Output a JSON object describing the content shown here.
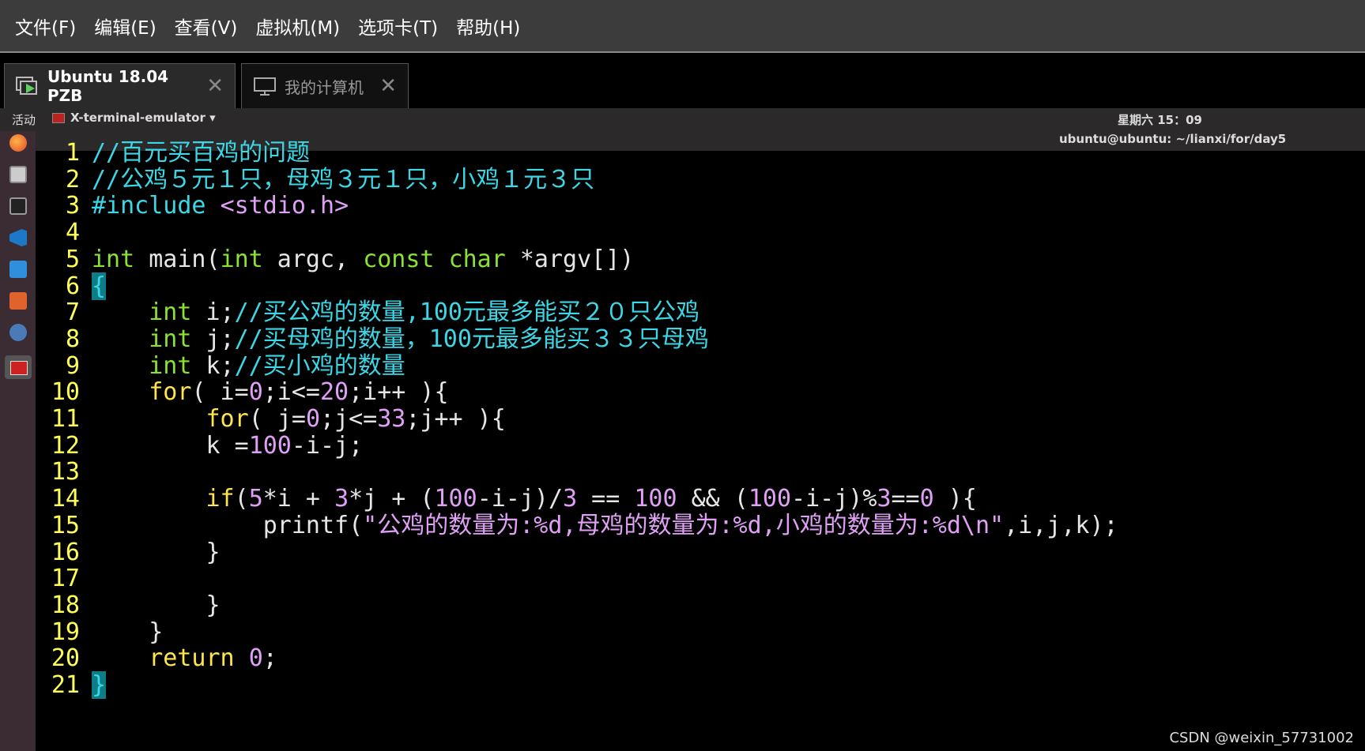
{
  "menubar": {
    "items": [
      "文件(F)",
      "编辑(E)",
      "查看(V)",
      "虚拟机(M)",
      "选项卡(T)",
      "帮助(H)"
    ]
  },
  "tabs": [
    {
      "label": "Ubuntu 18.04 PZB",
      "close": "✕",
      "icon": "vm-play-icon"
    },
    {
      "label": "我的计算机",
      "close": "✕",
      "icon": "monitor-icon"
    }
  ],
  "guest": {
    "activities": "活动",
    "app_menu": "X-terminal-emulator ▾",
    "clock": "星期六 15：09",
    "window_title": "ubuntu@ubuntu: ~/lianxi/for/day5"
  },
  "dock_icons": [
    "firefox-icon",
    "files-icon",
    "terminal-icon",
    "vscode-icon",
    "vim-icon",
    "software-center-icon",
    "settings-icon",
    "x-terminal-icon"
  ],
  "code": {
    "line_numbers": [
      "1",
      "2",
      "3",
      "4",
      "5",
      "6",
      "7",
      "8",
      "9",
      "10",
      "11",
      "12",
      "13",
      "14",
      "15",
      "16",
      "17",
      "18",
      "19",
      "20",
      "21"
    ],
    "lines": [
      [
        {
          "t": "//百元买百鸡的问题",
          "c": "c-comment"
        }
      ],
      [
        {
          "t": "//公鸡５元１只，母鸡３元１只，小鸡１元３只",
          "c": "c-comment"
        }
      ],
      [
        {
          "t": "#include ",
          "c": "c-pre"
        },
        {
          "t": "<stdio.h>",
          "c": "c-str"
        }
      ],
      [],
      [
        {
          "t": "int",
          "c": "c-type"
        },
        {
          "t": " main(",
          "c": "c-plain"
        },
        {
          "t": "int",
          "c": "c-type"
        },
        {
          "t": " argc, ",
          "c": "c-plain"
        },
        {
          "t": "const",
          "c": "c-type"
        },
        {
          "t": " ",
          "c": "c-plain"
        },
        {
          "t": "char",
          "c": "c-type"
        },
        {
          "t": " *argv[])",
          "c": "c-plain"
        }
      ],
      [
        {
          "t": "{",
          "c": "cursor-brace"
        }
      ],
      [
        {
          "t": "    ",
          "c": "c-plain"
        },
        {
          "t": "int",
          "c": "c-type"
        },
        {
          "t": " i;",
          "c": "c-plain"
        },
        {
          "t": "//买公鸡的数量,100元最多能买２０只公鸡",
          "c": "c-comment"
        }
      ],
      [
        {
          "t": "    ",
          "c": "c-plain"
        },
        {
          "t": "int",
          "c": "c-type"
        },
        {
          "t": " j;",
          "c": "c-plain"
        },
        {
          "t": "//买母鸡的数量，100元最多能买３３只母鸡",
          "c": "c-comment"
        }
      ],
      [
        {
          "t": "    ",
          "c": "c-plain"
        },
        {
          "t": "int",
          "c": "c-type"
        },
        {
          "t": " k;",
          "c": "c-plain"
        },
        {
          "t": "//买小鸡的数量",
          "c": "c-comment"
        }
      ],
      [
        {
          "t": "    ",
          "c": "c-plain"
        },
        {
          "t": "for",
          "c": "c-kw"
        },
        {
          "t": "( i=",
          "c": "c-plain"
        },
        {
          "t": "0",
          "c": "c-num"
        },
        {
          "t": ";i<=",
          "c": "c-plain"
        },
        {
          "t": "20",
          "c": "c-num"
        },
        {
          "t": ";i++ ){",
          "c": "c-plain"
        }
      ],
      [
        {
          "t": "        ",
          "c": "c-plain"
        },
        {
          "t": "for",
          "c": "c-kw"
        },
        {
          "t": "( j=",
          "c": "c-plain"
        },
        {
          "t": "0",
          "c": "c-num"
        },
        {
          "t": ";j<=",
          "c": "c-plain"
        },
        {
          "t": "33",
          "c": "c-num"
        },
        {
          "t": ";j++ ){",
          "c": "c-plain"
        }
      ],
      [
        {
          "t": "        k =",
          "c": "c-plain"
        },
        {
          "t": "100",
          "c": "c-num"
        },
        {
          "t": "-i-j;",
          "c": "c-plain"
        }
      ],
      [],
      [
        {
          "t": "        ",
          "c": "c-plain"
        },
        {
          "t": "if",
          "c": "c-kw"
        },
        {
          "t": "(",
          "c": "c-plain"
        },
        {
          "t": "5",
          "c": "c-num"
        },
        {
          "t": "*i + ",
          "c": "c-plain"
        },
        {
          "t": "3",
          "c": "c-num"
        },
        {
          "t": "*j + (",
          "c": "c-plain"
        },
        {
          "t": "100",
          "c": "c-num"
        },
        {
          "t": "-i-j)/",
          "c": "c-plain"
        },
        {
          "t": "3",
          "c": "c-num"
        },
        {
          "t": " == ",
          "c": "c-plain"
        },
        {
          "t": "100",
          "c": "c-num"
        },
        {
          "t": " && (",
          "c": "c-plain"
        },
        {
          "t": "100",
          "c": "c-num"
        },
        {
          "t": "-i-j)%",
          "c": "c-plain"
        },
        {
          "t": "3",
          "c": "c-num"
        },
        {
          "t": "==",
          "c": "c-plain"
        },
        {
          "t": "0",
          "c": "c-num"
        },
        {
          "t": " ){",
          "c": "c-plain"
        }
      ],
      [
        {
          "t": "            printf(",
          "c": "c-plain"
        },
        {
          "t": "\"公鸡的数量为:%d,母鸡的数量为:%d,小鸡的数量为:%d\\n\"",
          "c": "c-str"
        },
        {
          "t": ",i,j,k);",
          "c": "c-plain"
        }
      ],
      [
        {
          "t": "        }",
          "c": "c-plain"
        }
      ],
      [],
      [
        {
          "t": "        }",
          "c": "c-plain"
        }
      ],
      [
        {
          "t": "    }",
          "c": "c-plain"
        }
      ],
      [
        {
          "t": "    ",
          "c": "c-plain"
        },
        {
          "t": "return",
          "c": "c-kw"
        },
        {
          "t": " ",
          "c": "c-plain"
        },
        {
          "t": "0",
          "c": "c-num"
        },
        {
          "t": ";",
          "c": "c-plain"
        }
      ],
      [
        {
          "t": "}",
          "c": "cursor-brace"
        }
      ]
    ]
  },
  "watermark": "CSDN @weixin_57731002"
}
